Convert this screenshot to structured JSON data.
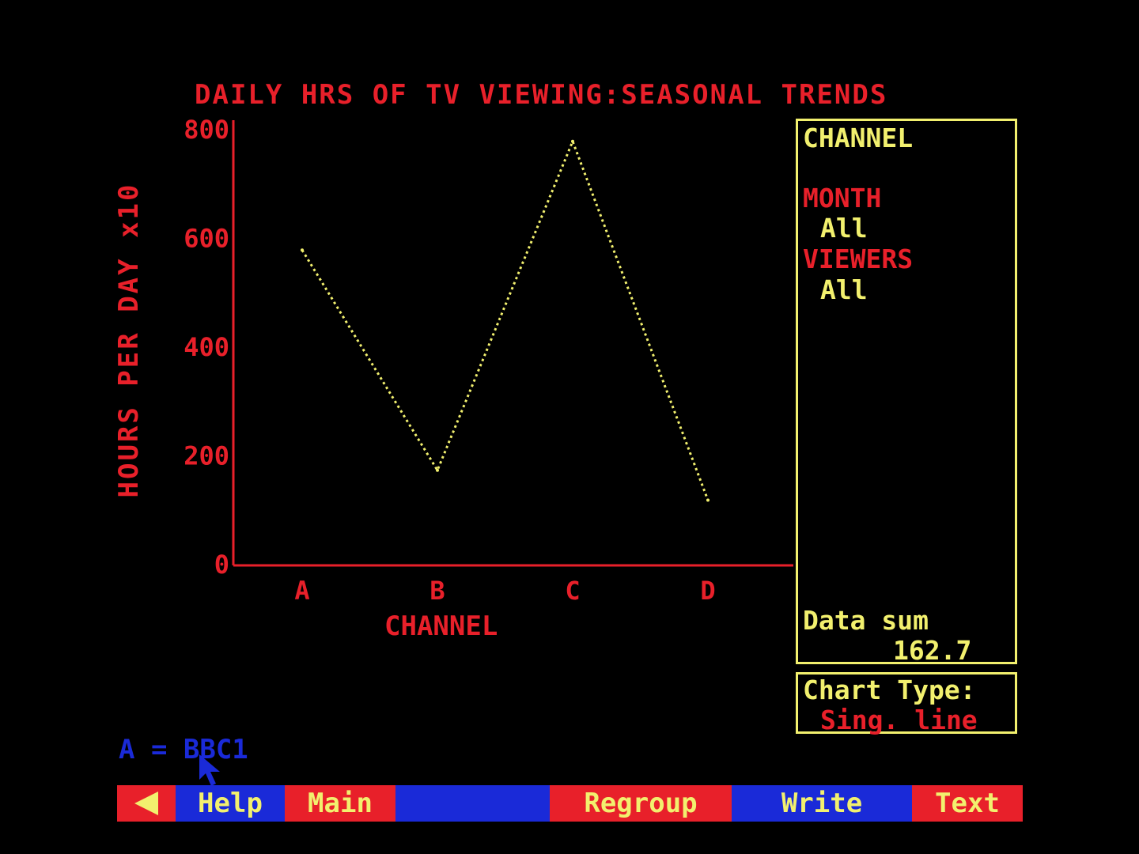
{
  "chart_data": {
    "type": "line",
    "title": "DAILY HRS OF TV VIEWING:SEASONAL TRENDS",
    "xlabel": "CHANNEL",
    "ylabel": "HOURS PER DAY x10",
    "categories": [
      "A",
      "B",
      "C",
      "D"
    ],
    "values": [
      580,
      175,
      780,
      120
    ],
    "yticks": [
      "0",
      "200",
      "400",
      "600",
      "800"
    ],
    "ylim": [
      0,
      800
    ],
    "grid": false,
    "line_color": "#f2f06e",
    "axis_color": "#e8202a"
  },
  "side_panel": {
    "heading": "CHANNEL",
    "month_label": "MONTH",
    "month_value": "All",
    "viewers_label": "VIEWERS",
    "viewers_value": "All",
    "data_sum_label": "Data sum",
    "data_sum_value": "162.7"
  },
  "chart_type_box": {
    "label": "Chart Type:",
    "value": "Sing. line"
  },
  "status_line": "A = BBC1",
  "menu": {
    "back_icon": "left-arrow-icon",
    "help": "Help",
    "main": "Main",
    "empty": "",
    "regroup": "Regroup",
    "write": "Write",
    "text": "Text"
  }
}
